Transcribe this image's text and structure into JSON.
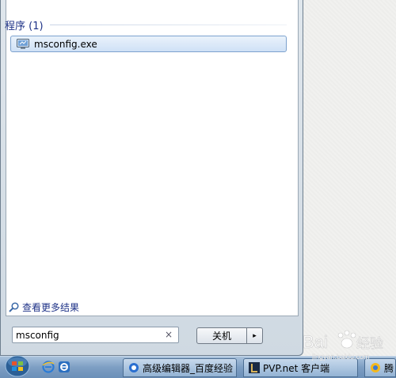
{
  "search_results": {
    "group_title": "程序 (1)",
    "items": [
      {
        "label": "msconfig.exe",
        "icon": "msconfig-app-icon"
      }
    ],
    "see_more_label": "查看更多结果"
  },
  "search": {
    "value": "msconfig",
    "clear_glyph": "×"
  },
  "shutdown": {
    "label": "关机",
    "arrow_glyph": "▸"
  },
  "taskbar": {
    "quick_launch": [
      "internet-explorer-icon",
      "ie-alt-icon"
    ],
    "tasks": [
      {
        "label": "高级编辑器_百度经验",
        "icon": "browser-icon"
      },
      {
        "label": "PVP.net 客户端",
        "icon": "pvp-net-icon"
      },
      {
        "label": "腾",
        "icon": "tencent-icon"
      }
    ]
  },
  "watermark": {
    "brand": "Bai",
    "suffix": "经验",
    "url": "jingyan.baidu.com"
  },
  "colors": {
    "accent_blue": "#1e3287",
    "selection_border": "#7da2ce",
    "taskbar": "#7d9ec3"
  }
}
